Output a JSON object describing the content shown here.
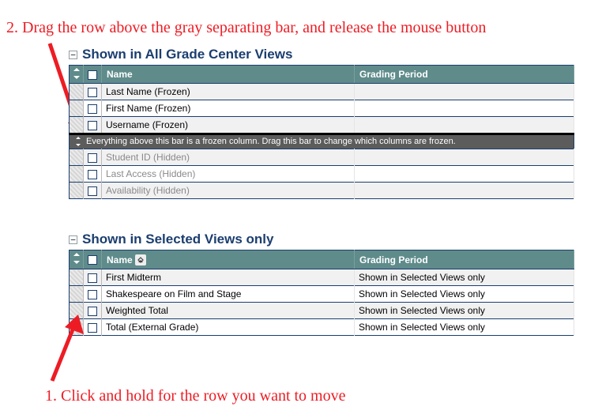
{
  "annotations": {
    "top": "2. Drag the row above the gray separating bar, and release the mouse button",
    "bottom": "1. Click and hold for the row you want to move"
  },
  "toggle_glyph": "−",
  "section1": {
    "title": "Shown in All Grade Center Views",
    "headers": {
      "name": "Name",
      "grading_period": "Grading Period"
    },
    "separator_text": "Everything above this bar is a frozen column. Drag this bar to change which columns are frozen.",
    "rows_above": [
      {
        "name": "Last Name (Frozen)",
        "gp": ""
      },
      {
        "name": "First Name (Frozen)",
        "gp": ""
      },
      {
        "name": "Username (Frozen)",
        "gp": ""
      }
    ],
    "rows_below": [
      {
        "name": "Student ID  (Hidden)",
        "gp": ""
      },
      {
        "name": "Last Access  (Hidden)",
        "gp": ""
      },
      {
        "name": "Availability  (Hidden)",
        "gp": ""
      }
    ]
  },
  "section2": {
    "title": "Shown in Selected Views only",
    "headers": {
      "name": "Name",
      "grading_period": "Grading Period"
    },
    "rows": [
      {
        "name": "First Midterm",
        "gp": "Shown in Selected Views only"
      },
      {
        "name": "Shakespeare on Film and Stage",
        "gp": "Shown in Selected Views only"
      },
      {
        "name": "Weighted Total",
        "gp": "Shown in Selected Views only"
      },
      {
        "name": "Total (External Grade)",
        "gp": "Shown in Selected Views only"
      }
    ]
  }
}
